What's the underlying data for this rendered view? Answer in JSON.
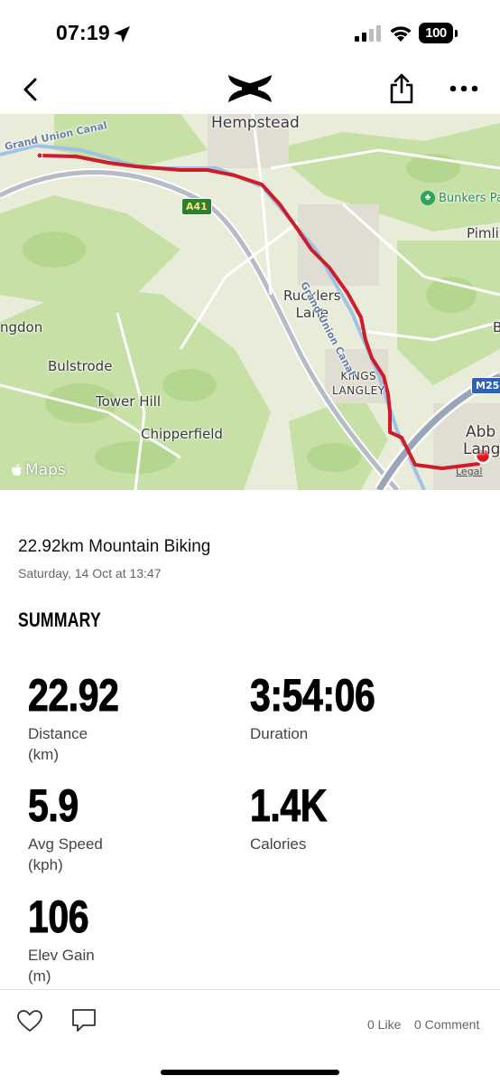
{
  "status_bar": {
    "time": "07:19",
    "battery": "100"
  },
  "nav": {
    "back_icon": "chevron-left-icon",
    "logo": "under-armour-logo",
    "share_icon": "share-icon",
    "more_icon": "more-icon"
  },
  "map": {
    "labels": {
      "hempstead": "Hempstead",
      "bunkers_park": "Bunkers Pa",
      "pimlico": "Pimli",
      "rucklers_lane": "Rucklers\nLane",
      "ngdon": "ngdon",
      "bulstrode": "Bulstrode",
      "kings_langley": "KINGS\nLANGLEY",
      "tower_hill": "Tower Hill",
      "chipperfield": "Chipperfield",
      "abb": "Abb",
      "lang": "Lang",
      "b": "B",
      "canal_1": "Grand Union Canal",
      "canal_2": "Grand Union Canal"
    },
    "road_a41": "A41",
    "road_m25": "M25",
    "watermark": "Maps",
    "legal": "Legal",
    "route_color": "#d11a2a"
  },
  "workout": {
    "title": "22.92km Mountain Biking",
    "date": "Saturday, 14 Oct at 13:47"
  },
  "summary": {
    "heading": "SUMMARY",
    "stats": [
      {
        "value": "22.92",
        "label": "Distance\n(km)"
      },
      {
        "value": "3:54:06",
        "label": "Duration"
      },
      {
        "value": "5.9",
        "label": "Avg Speed\n(kph)"
      },
      {
        "value": "1.4K",
        "label": "Calories"
      },
      {
        "value": "106",
        "label": "Elev Gain\n(m)"
      }
    ]
  },
  "actions": {
    "like_count": "0 Like",
    "comment_count": "0 Comment"
  }
}
